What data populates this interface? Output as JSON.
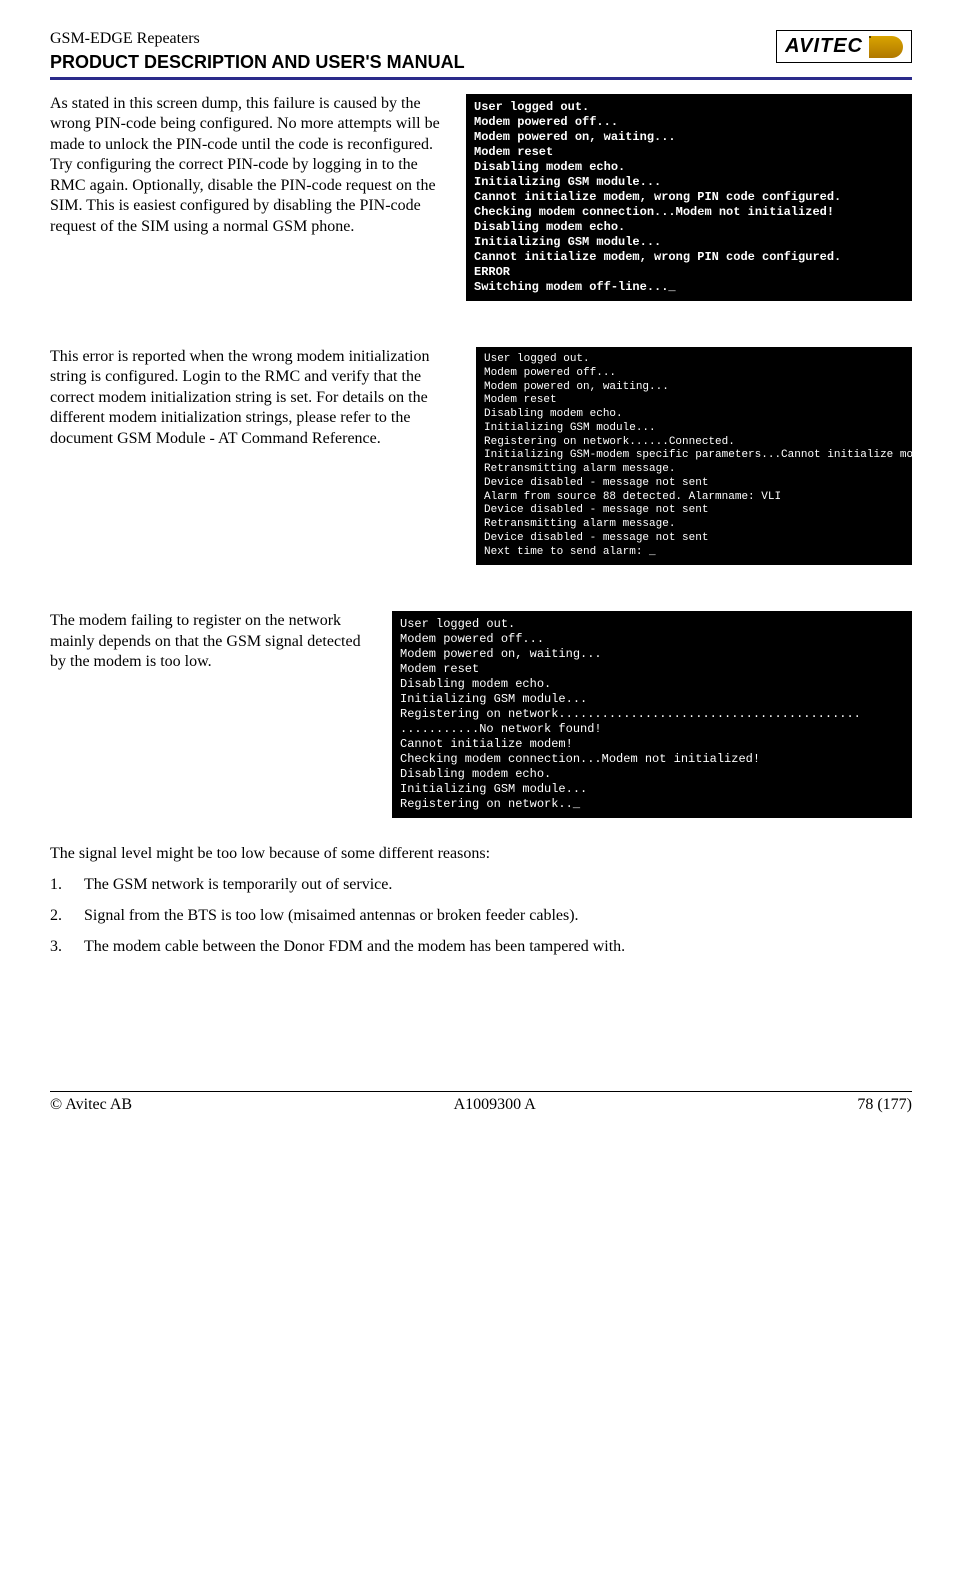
{
  "header": {
    "line1": "GSM-EDGE Repeaters",
    "line2": "PRODUCT DESCRIPTION AND USER'S MANUAL",
    "logo_text": "AVITEC"
  },
  "section1": {
    "text": "As stated in this screen dump, this failure is caused by the wrong PIN-code being configured. No more attempts will be made to unlock the PIN-code until the code is reconfigured. Try configuring the correct PIN-code by logging in to the RMC again. Optionally, disable the PIN-code request on the SIM. This is easiest configured by disabling the PIN-code request of the SIM using a normal GSM phone.",
    "terminal": "User logged out.\nModem powered off...\nModem powered on, waiting...\nModem reset\nDisabling modem echo.\nInitializing GSM module...\nCannot initialize modem, wrong PIN code configured.\nChecking modem connection...Modem not initialized!\nDisabling modem echo.\nInitializing GSM module...\nCannot initialize modem, wrong PIN code configured.\nERROR\nSwitching modem off-line..._"
  },
  "section2": {
    "text": "This error is reported when the wrong modem initialization string is configured. Login to the RMC and verify that the correct modem initialization string is set. For details on the different modem initialization strings, please refer to the document GSM Module - AT Command Reference.",
    "terminal": "User logged out.\nModem powered off...\nModem powered on, waiting...\nModem reset\nDisabling modem echo.\nInitializing GSM module...\nRegistering on network......Connected.\nInitializing GSM-modem specific parameters...Cannot initialize modem!\nRetransmitting alarm message.\nDevice disabled - message not sent\nAlarm from source 88 detected. Alarmname: VLI\nDevice disabled - message not sent\nRetransmitting alarm message.\nDevice disabled - message not sent\nNext time to send alarm: _"
  },
  "section3": {
    "text": "The modem failing to register on the network mainly depends on that the GSM signal detected by the modem is too low.",
    "terminal": "User logged out.\nModem powered off...\nModem powered on, waiting...\nModem reset\nDisabling modem echo.\nInitializing GSM module...\nRegistering on network..........................................\n...........No network found!\nCannot initialize modem!\nChecking modem connection...Modem not initialized!\nDisabling modem echo.\nInitializing GSM module...\nRegistering on network.._"
  },
  "para_after": "The signal level might be too low because of some different reasons:",
  "list": [
    "The GSM network is temporarily out of service.",
    "Signal from the BTS is too low (misaimed antennas or broken feeder cables).",
    "The modem cable between the Donor FDM and the modem has been tampered with."
  ],
  "footer": {
    "left": "© Avitec AB",
    "center": "A1009300 A",
    "right": "78 (177)"
  }
}
